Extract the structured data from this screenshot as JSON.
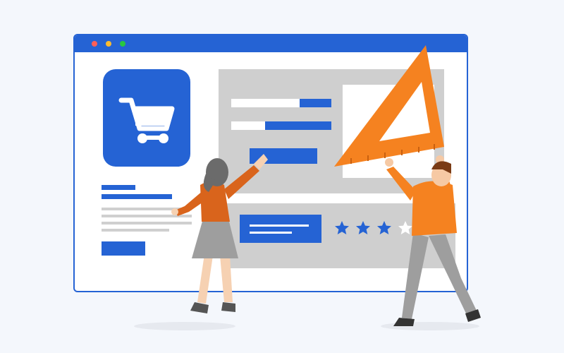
{
  "colors": {
    "accent": "#2563d4",
    "panel": "#cfcfcf",
    "background": "#f4f7fc",
    "window_dot_red": "#ff5f57",
    "window_dot_yellow": "#febc2e",
    "window_dot_green": "#28c840",
    "orange": "#f58220",
    "person_shirt_left": "#d9641c",
    "person_shirt_right": "#f58220",
    "skirt": "#9e9e9e",
    "pants": "#9e9e9e",
    "hair_left": "#6b6b6b",
    "hair_right": "#7a3b15",
    "star_filled": "#2563d4",
    "star_empty": "#ffffff"
  },
  "icons": {
    "cart": "shopping-cart-icon",
    "star": "star-icon"
  },
  "rating": {
    "filled": 3,
    "max": 5
  },
  "form": {
    "field_1_fill_fraction": 0.32,
    "field_2_fill_fraction": 0.66
  }
}
